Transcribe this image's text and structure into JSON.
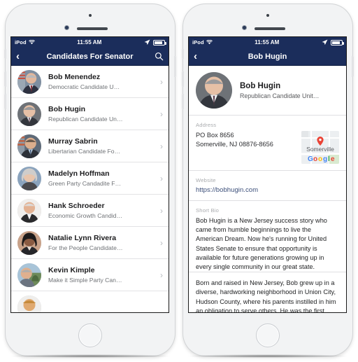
{
  "accent_navy": "#1b2d5b",
  "phone_left": {
    "status_bar": {
      "carrier": "iPod",
      "time": "11:55 AM",
      "wifi_icon": "wifi-icon",
      "location_icon": "location-arrow-icon",
      "battery_icon": "battery-icon"
    },
    "nav": {
      "back_icon": "chevron-left-icon",
      "title": "Candidates For Senator",
      "search_icon": "search-icon"
    },
    "list": [
      {
        "name": "Bob Menendez",
        "subtitle": "Democratic Candidate U…",
        "avatar": "portrait-bob-menendez"
      },
      {
        "name": "Bob Hugin",
        "subtitle": "Republican Candidate Un…",
        "avatar": "portrait-bob-hugin"
      },
      {
        "name": "Murray Sabrin",
        "subtitle": "Libertarian Candidate Fo…",
        "avatar": "portrait-murray-sabrin"
      },
      {
        "name": "Madelyn Hoffman",
        "subtitle": "Green Party Candadite F…",
        "avatar": "portrait-madelyn-hoffman"
      },
      {
        "name": "Hank Schroeder",
        "subtitle": "Economic Growth Candid…",
        "avatar": "portrait-hank-schroeder"
      },
      {
        "name": "Natalie Lynn Rivera",
        "subtitle": "For the People Candidate…",
        "avatar": "portrait-natalie-lynn-rivera"
      },
      {
        "name": "Kevin Kimple",
        "subtitle": "Make it Simple Party Can…",
        "avatar": "portrait-kevin-kimple"
      }
    ],
    "chevron": "›"
  },
  "phone_right": {
    "status_bar": {
      "carrier": "iPod",
      "time": "11:55 AM",
      "wifi_icon": "wifi-icon",
      "location_icon": "location-arrow-icon",
      "battery_icon": "battery-icon"
    },
    "nav": {
      "back_icon": "chevron-left-icon",
      "title": "Bob Hugin"
    },
    "profile": {
      "name": "Bob Hugin",
      "subtitle": "Republican Candidate Unit…",
      "avatar": "portrait-bob-hugin"
    },
    "address": {
      "label": "Address",
      "line1": "PO Box 8656",
      "line2": "Somerville, NJ 08876-8656",
      "map": {
        "place_label": "Somerville",
        "brand": "Google",
        "pin_icon": "map-pin-icon"
      }
    },
    "website": {
      "label": "Website",
      "url": "https://bobhugin.com"
    },
    "bio": {
      "label": "Short Bio",
      "paragraph_1": "Bob Hugin is a New Jersey success story who came from humble beginnings to live the American Dream. Now he's running for United States Senate to ensure that opportunity is available for future generations growing up in every single community in our great state.",
      "paragraph_2": "Born and raised in New Jersey, Bob grew up in a diverse, hardworking neighborhood in Union City, Hudson County, where his parents instilled in him an obligation to serve others. He was the first person in his family"
    }
  }
}
